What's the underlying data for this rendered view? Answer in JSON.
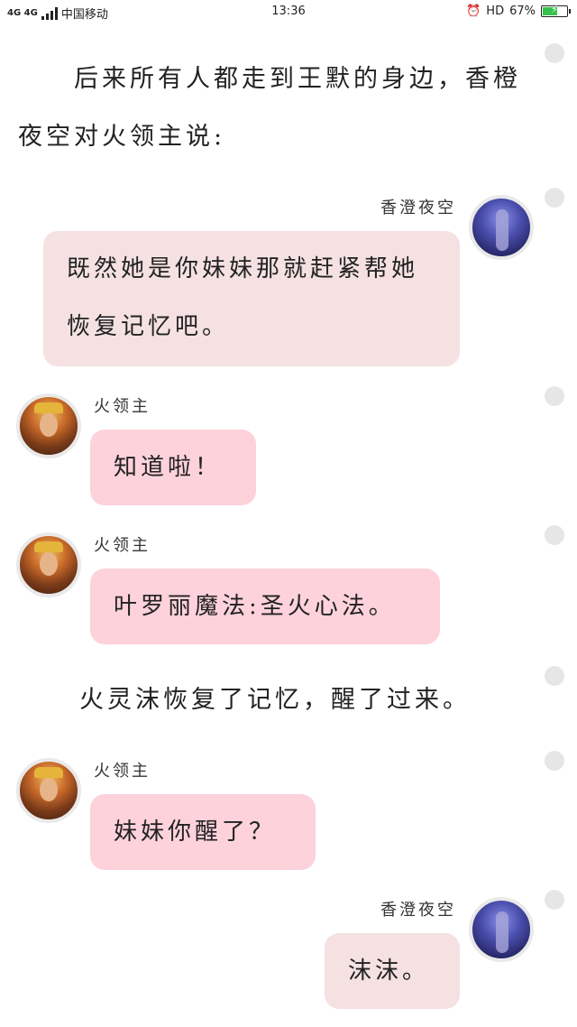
{
  "status_bar": {
    "network_tag": "4G 4G",
    "carrier": "中国移动",
    "time": "13:36",
    "hd": "HD",
    "battery": "67%",
    "battery_level": 0.67
  },
  "messages": {
    "narration_1": "后来所有人都走到王默的身边，香橙夜空对火领主说:",
    "msg_1": {
      "sender": "香澄夜空",
      "text": "既然她是你妹妹那就赶紧帮她恢复记忆吧。"
    },
    "msg_2": {
      "sender": "火领主",
      "text": "知道啦！"
    },
    "msg_3": {
      "sender": "火领主",
      "text": "叶罗丽魔法:圣火心法。"
    },
    "narration_2": "火灵沫恢复了记忆，醒了过来。",
    "msg_4": {
      "sender": "火领主",
      "text": "妹妹你醒了？"
    },
    "msg_5": {
      "sender": "香澄夜空",
      "text": "沫沫。"
    }
  },
  "colors": {
    "bubble_right": "#f5e1e1",
    "bubble_left": "#fdd2db",
    "dot": "#e6e6e6",
    "battery_fill": "#36c24a"
  },
  "icons": [
    "signal-bars-icon",
    "alarm-icon",
    "battery-icon",
    "avatar-xiangcheng",
    "avatar-huolingzhu"
  ]
}
